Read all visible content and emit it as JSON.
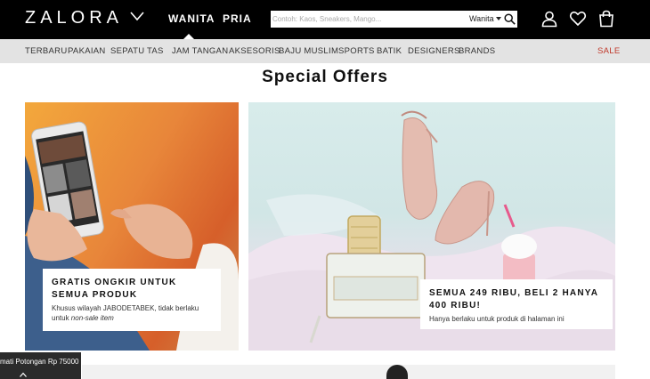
{
  "header": {
    "logo": "ZALORA",
    "gender_tabs": [
      {
        "label": "WANITA",
        "active": true
      },
      {
        "label": "PRIA",
        "active": false
      }
    ],
    "search": {
      "placeholder": "Contoh: Kaos, Sneakers, Mango...",
      "category": "Wanita"
    },
    "icons": [
      "user-icon",
      "heart-icon",
      "shopping-bag-icon"
    ]
  },
  "categories": [
    {
      "label": "TERBARU"
    },
    {
      "label": "PAKAIAN"
    },
    {
      "label": "SEPATU"
    },
    {
      "label": "TAS"
    },
    {
      "label": "JAM TANGAN"
    },
    {
      "label": "AKSESORIS"
    },
    {
      "label": "BAJU MUSLIM"
    },
    {
      "label": "SPORTS"
    },
    {
      "label": "BATIK"
    },
    {
      "label": "DESIGNERS"
    },
    {
      "label": "BRANDS"
    },
    {
      "label": "SALE"
    }
  ],
  "main": {
    "title": "Special Offers",
    "offers": [
      {
        "title": "GRATIS ONGKIR UNTUK SEMUA PRODUK",
        "desc_prefix": "Khusus wilayah JABODETABEK, tidak berlaku untuk ",
        "desc_emphasis": "non-sale item"
      },
      {
        "title": "SEMUA 249 RIBU, BELI 2 HANYA 400 RIBU!",
        "desc": "Hanya berlaku untuk produk di halaman ini"
      }
    ]
  },
  "ticker": {
    "text": "mati Potongan Rp 75000"
  },
  "colors": {
    "header_bg": "#000000",
    "nav_bg": "#e3e3e3",
    "sale": "#c0392b"
  }
}
